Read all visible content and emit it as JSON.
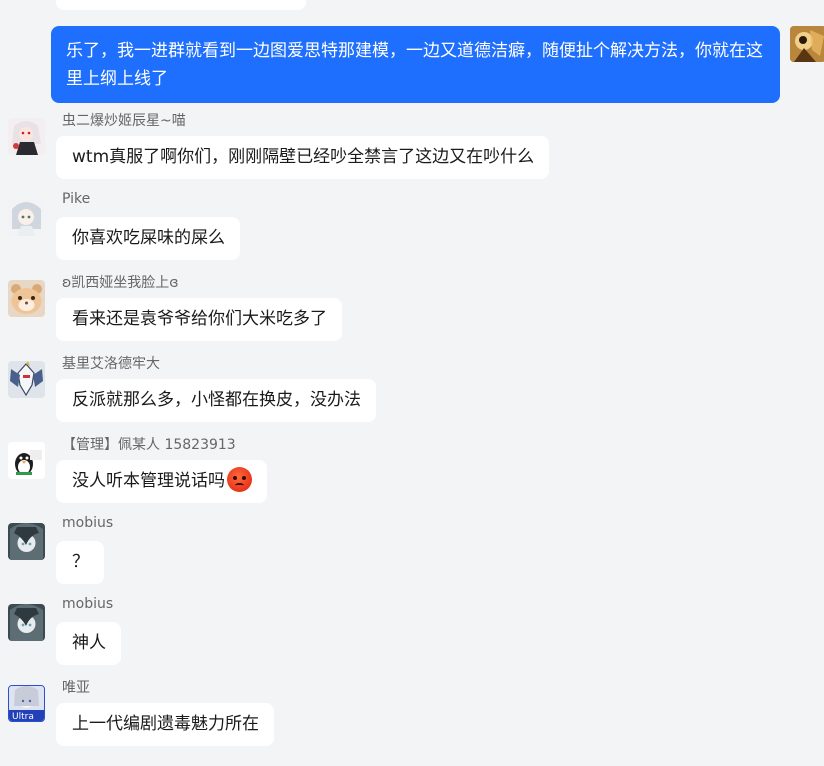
{
  "self_message": {
    "text": "乐了，我一进群就看到一边图爱思特那建模，一边又道德洁癖，随便扯个解决方法，你就在这里上纲上线了"
  },
  "messages": [
    {
      "sender": "虫二爆炒姬辰星~喵",
      "text": "wtm真服了啊你们，刚刚隔壁已经吵全禁言了这边又在吵什么",
      "avatar_icon": "anime-girl-avatar"
    },
    {
      "sender": "Pike",
      "text": "你喜欢吃屎味的屎么",
      "avatar_icon": "anime-avatar"
    },
    {
      "sender": "ʚ凯西娅坐我脸上ɞ",
      "text": "看来还是袁爷爷给你们大米吃多了",
      "avatar_icon": "hamster-avatar"
    },
    {
      "sender": "基里艾洛德牢大",
      "text": "反派就那么多，小怪都在换皮，没办法",
      "avatar_icon": "mecha-avatar"
    },
    {
      "sender": "【管理】佩某人 15823913",
      "text": "没人听本管理说话吗",
      "emoji": "angry-face-emoji",
      "avatar_icon": "penguin-avatar"
    },
    {
      "sender": "mobius",
      "text": "？",
      "avatar_icon": "anime-avatar"
    },
    {
      "sender": "mobius",
      "text": "神人",
      "avatar_icon": "anime-avatar"
    },
    {
      "sender": "唯亚",
      "text": "上一代编剧遗毒魅力所在",
      "avatar_icon": "ultra-avatar"
    }
  ]
}
